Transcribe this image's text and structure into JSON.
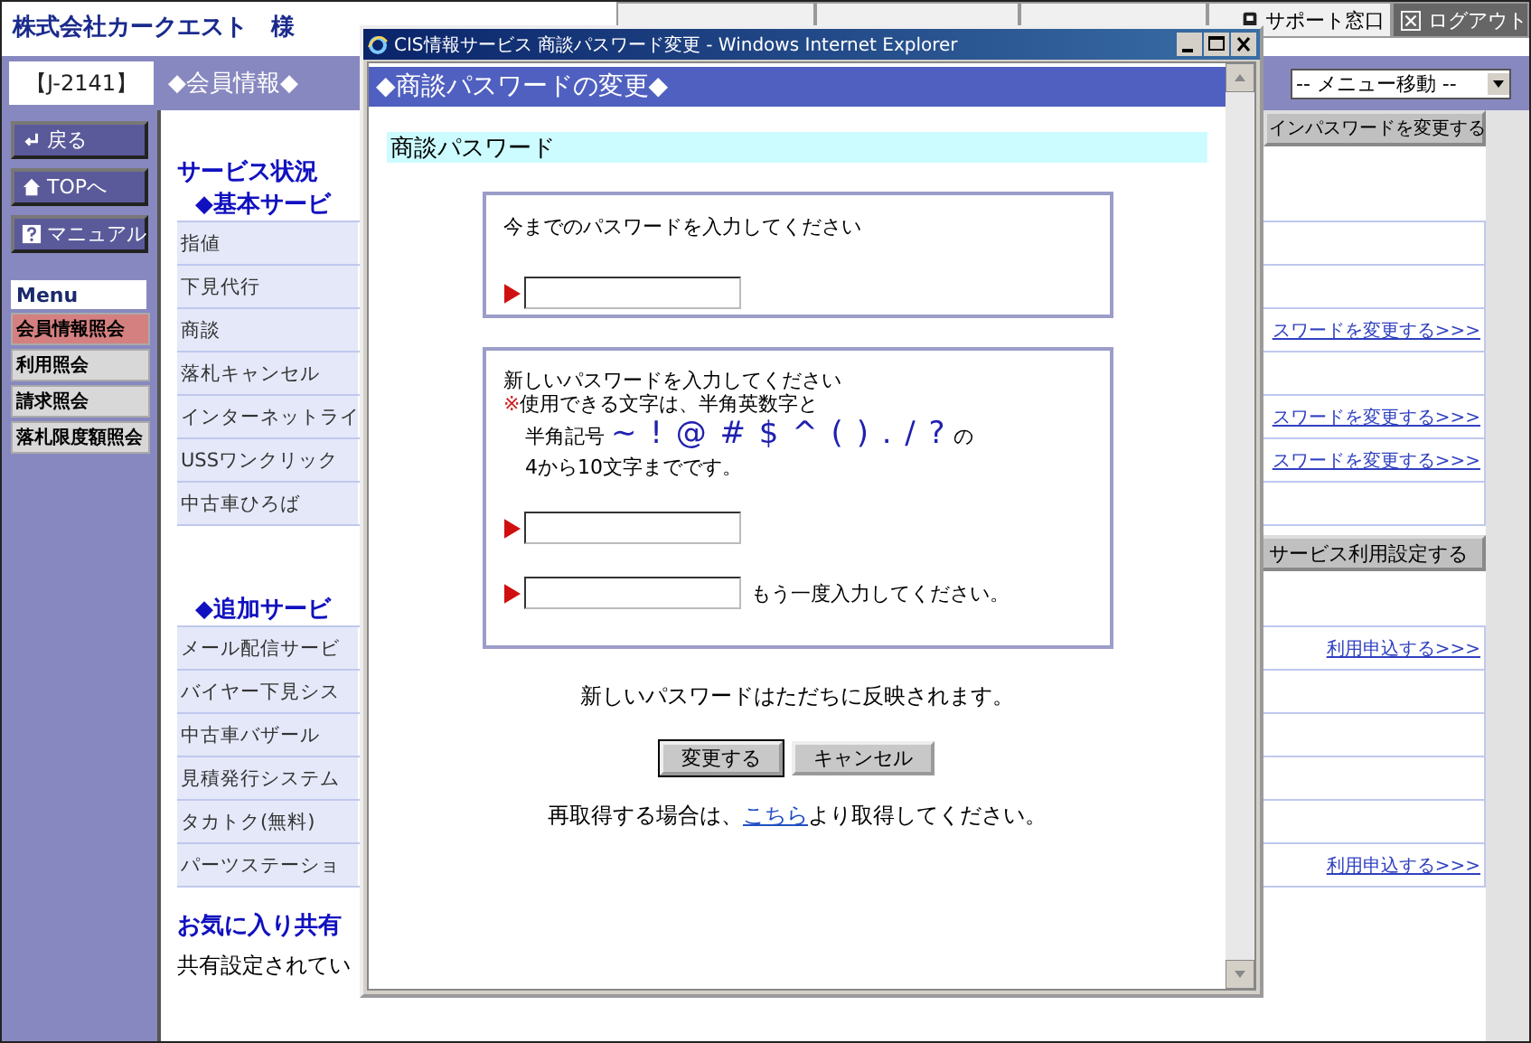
{
  "header": {
    "company": "株式会社カークエスト　様",
    "nav": [
      {
        "label": "サポート窓口",
        "kind": "tab"
      },
      {
        "label": "ログアウト",
        "kind": "logout"
      }
    ]
  },
  "member_bar": {
    "member_id": "【J-2141】",
    "section_title": "◆会員情報◆",
    "menu_select": "-- メニュー移動 --"
  },
  "sidebar": {
    "buttons": [
      {
        "label": "戻る"
      },
      {
        "label": "TOPへ"
      },
      {
        "label": "マニュアル"
      }
    ],
    "menu_title": "Menu",
    "menu_items": [
      {
        "label": "会員情報照会",
        "selected": true
      },
      {
        "label": "利用照会",
        "selected": false
      },
      {
        "label": "請求照会",
        "selected": false
      },
      {
        "label": "落札限度額照会",
        "selected": false
      }
    ]
  },
  "main": {
    "login_password_button": "インパスワードを変更する",
    "service_status_title": "サービス状況",
    "basic_heading": "◆基本サービ",
    "basic_services": [
      {
        "name": "指値"
      },
      {
        "name": "下見代行"
      },
      {
        "name": "商談",
        "link": "スワードを変更する>>>"
      },
      {
        "name": "落札キャンセル"
      },
      {
        "name": "インターネットライ",
        "link": "スワードを変更する>>>"
      },
      {
        "name": "USSワンクリック",
        "link": "スワードを変更する>>>"
      },
      {
        "name": "中古車ひろば"
      }
    ],
    "service_settings_button": "サービス利用設定する",
    "additional_heading": "◆追加サービ",
    "additional_services": [
      {
        "name": "メール配信サービ",
        "link": "利用申込する>>>"
      },
      {
        "name": "バイヤー下見シス"
      },
      {
        "name": "中古車バザール"
      },
      {
        "name": "見積発行システム"
      },
      {
        "name": "タカトク(無料)"
      },
      {
        "name": "パーツステーショ",
        "link": "利用申込する>>>"
      }
    ],
    "favorites_heading": "お気に入り共有",
    "favorites_text": "共有設定されてい"
  },
  "popup": {
    "title": "CIS情報サービス 商談パスワード変更 - Windows Internet Explorer",
    "heading": "◆商談パスワードの変更◆",
    "section_label": "商談パスワード",
    "current_password": {
      "prompt": "今までのパスワードを入力してください"
    },
    "new_password": {
      "prompt": "新しいパスワードを入力してください",
      "note_mark": "※",
      "note": "使用できる文字は、半角英数字と",
      "symbols_prefix": "半角記号",
      "symbols": "~ ! @ # $ ^ ( ) . / ?",
      "symbols_suffix": "の",
      "length_rule": "4から10文字までです。",
      "confirm_hint": "もう一度入力してください。"
    },
    "notice": "新しいパスワードはただちに反映されます。",
    "buttons": [
      {
        "label": "変更する",
        "default": true
      },
      {
        "label": "キャンセル",
        "default": false
      }
    ],
    "retrieve": {
      "before": "再取得する場合は、",
      "link": "こちら",
      "after": "より取得してください。"
    }
  }
}
